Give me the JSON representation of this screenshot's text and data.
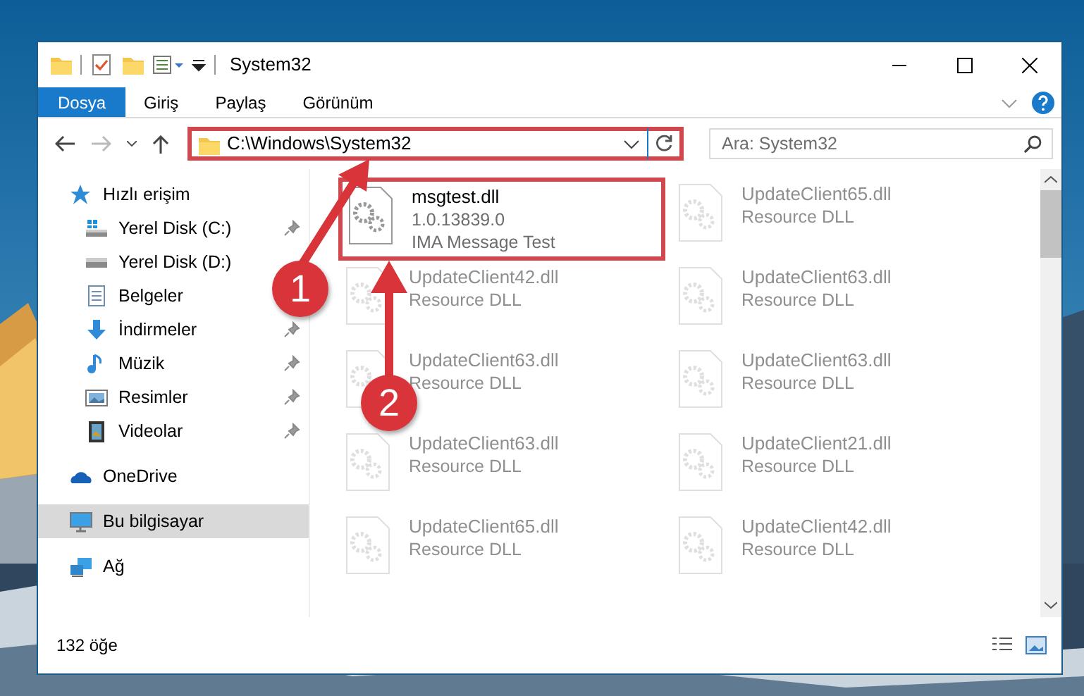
{
  "window": {
    "title": "System32"
  },
  "ribbon_tabs": [
    {
      "label": "Dosya",
      "selected": true
    },
    {
      "label": "Giriş",
      "selected": false
    },
    {
      "label": "Paylaş",
      "selected": false
    },
    {
      "label": "Görünüm",
      "selected": false
    }
  ],
  "address_bar": {
    "path": "C:\\Windows\\System32",
    "highlighted": true
  },
  "search": {
    "placeholder": "Ara: System32"
  },
  "sidebar": {
    "items": [
      {
        "label": "Hızlı erişim",
        "kind": "star",
        "pinned": false,
        "selected": false,
        "children": [
          {
            "label": "Yerel Disk (C:)",
            "kind": "drive-win",
            "pinned": true,
            "selected": false
          },
          {
            "label": "Yerel Disk (D:)",
            "kind": "drive",
            "pinned": false,
            "selected": false
          },
          {
            "label": "Belgeler",
            "kind": "document",
            "pinned": false,
            "selected": false
          },
          {
            "label": "İndirmeler",
            "kind": "download",
            "pinned": true,
            "selected": false
          },
          {
            "label": "Müzik",
            "kind": "music",
            "pinned": true,
            "selected": false
          },
          {
            "label": "Resimler",
            "kind": "pictures",
            "pinned": true,
            "selected": false
          },
          {
            "label": "Videolar",
            "kind": "video",
            "pinned": true,
            "selected": false
          }
        ]
      },
      {
        "label": "OneDrive",
        "kind": "cloud",
        "pinned": false,
        "selected": false
      },
      {
        "label": "Bu bilgisayar",
        "kind": "computer",
        "pinned": false,
        "selected": true
      },
      {
        "label": "Ağ",
        "kind": "network",
        "pinned": false,
        "selected": false
      }
    ]
  },
  "files": [
    {
      "name": "msgtest.dll",
      "lines": [
        "1.0.13839.0",
        "IMA Message Test"
      ],
      "faded": false,
      "highlighted": true
    },
    {
      "name": "UpdateClient65.dll",
      "lines": [
        "Resource DLL"
      ],
      "faded": true,
      "highlighted": false
    },
    {
      "name": "UpdateClient42.dll",
      "lines": [
        "Resource DLL"
      ],
      "faded": true,
      "highlighted": false
    },
    {
      "name": "UpdateClient63.dll",
      "lines": [
        "Resource DLL"
      ],
      "faded": true,
      "highlighted": false
    },
    {
      "name": "UpdateClient63.dll",
      "lines": [
        "Resource DLL"
      ],
      "faded": true,
      "highlighted": false
    },
    {
      "name": "UpdateClient63.dll",
      "lines": [
        "Resource DLL"
      ],
      "faded": true,
      "highlighted": false
    },
    {
      "name": "UpdateClient63.dll",
      "lines": [
        "Resource DLL"
      ],
      "faded": true,
      "highlighted": false
    },
    {
      "name": "UpdateClient21.dll",
      "lines": [
        "Resource DLL"
      ],
      "faded": true,
      "highlighted": false
    },
    {
      "name": "UpdateClient65.dll",
      "lines": [
        "Resource DLL"
      ],
      "faded": true,
      "highlighted": false
    },
    {
      "name": "UpdateClient42.dll",
      "lines": [
        "Resource DLL"
      ],
      "faded": true,
      "highlighted": false
    }
  ],
  "status_bar": {
    "item_count": "132 öğe"
  },
  "annotations": [
    {
      "label": "1"
    },
    {
      "label": "2"
    }
  ]
}
